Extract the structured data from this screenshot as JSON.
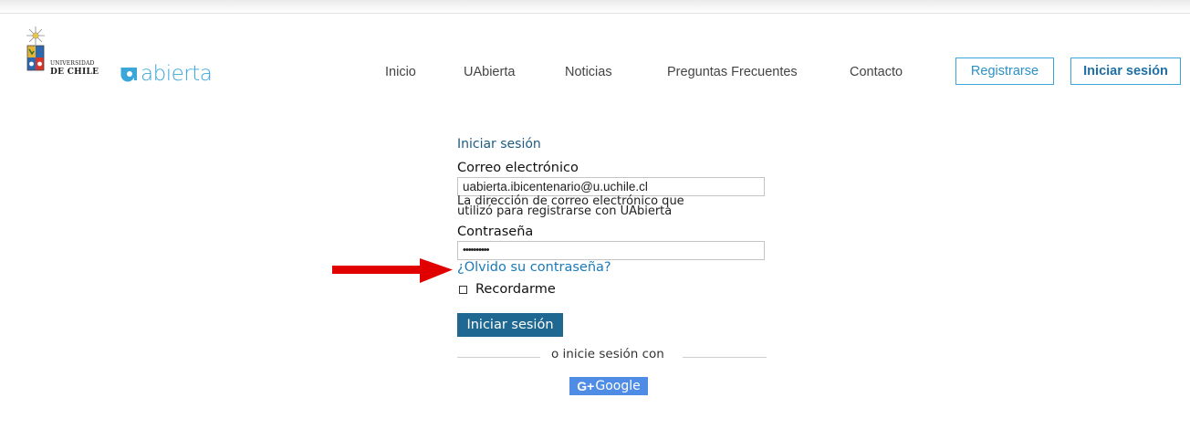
{
  "brand": {
    "university_line1": "UNIVERSIDAD",
    "university_line2": "DE CHILE",
    "product_name": "abierta",
    "accent_color": "#3aa6d9"
  },
  "nav": {
    "items": [
      "Inicio",
      "UAbierta",
      "Noticias",
      "Preguntas Frecuentes",
      "Contacto"
    ],
    "register_label": "Registrarse",
    "login_label": "Iniciar sesión"
  },
  "form": {
    "title": "Iniciar sesión",
    "email_label": "Correo electrónico",
    "email_value": "uabierta.ibicentenario@u.uchile.cl",
    "email_help_line1": "La dirección de correo electrónico que",
    "email_help_line2": "utilizó para registrarse con UAbierta",
    "password_label": "Contraseña",
    "password_value": "••••••••••",
    "forgot_link": "¿Olvido su contraseña?",
    "remember_label": "Recordarme",
    "submit_label": "Iniciar sesión",
    "separator_text": "o inicie sesión con",
    "google_g": "G+",
    "google_label": "Google"
  },
  "colors": {
    "submit_bg": "#1f6891",
    "link": "#1a7ab8",
    "google_bg": "#4f8ce6",
    "annotation_arrow": "#e00000"
  }
}
